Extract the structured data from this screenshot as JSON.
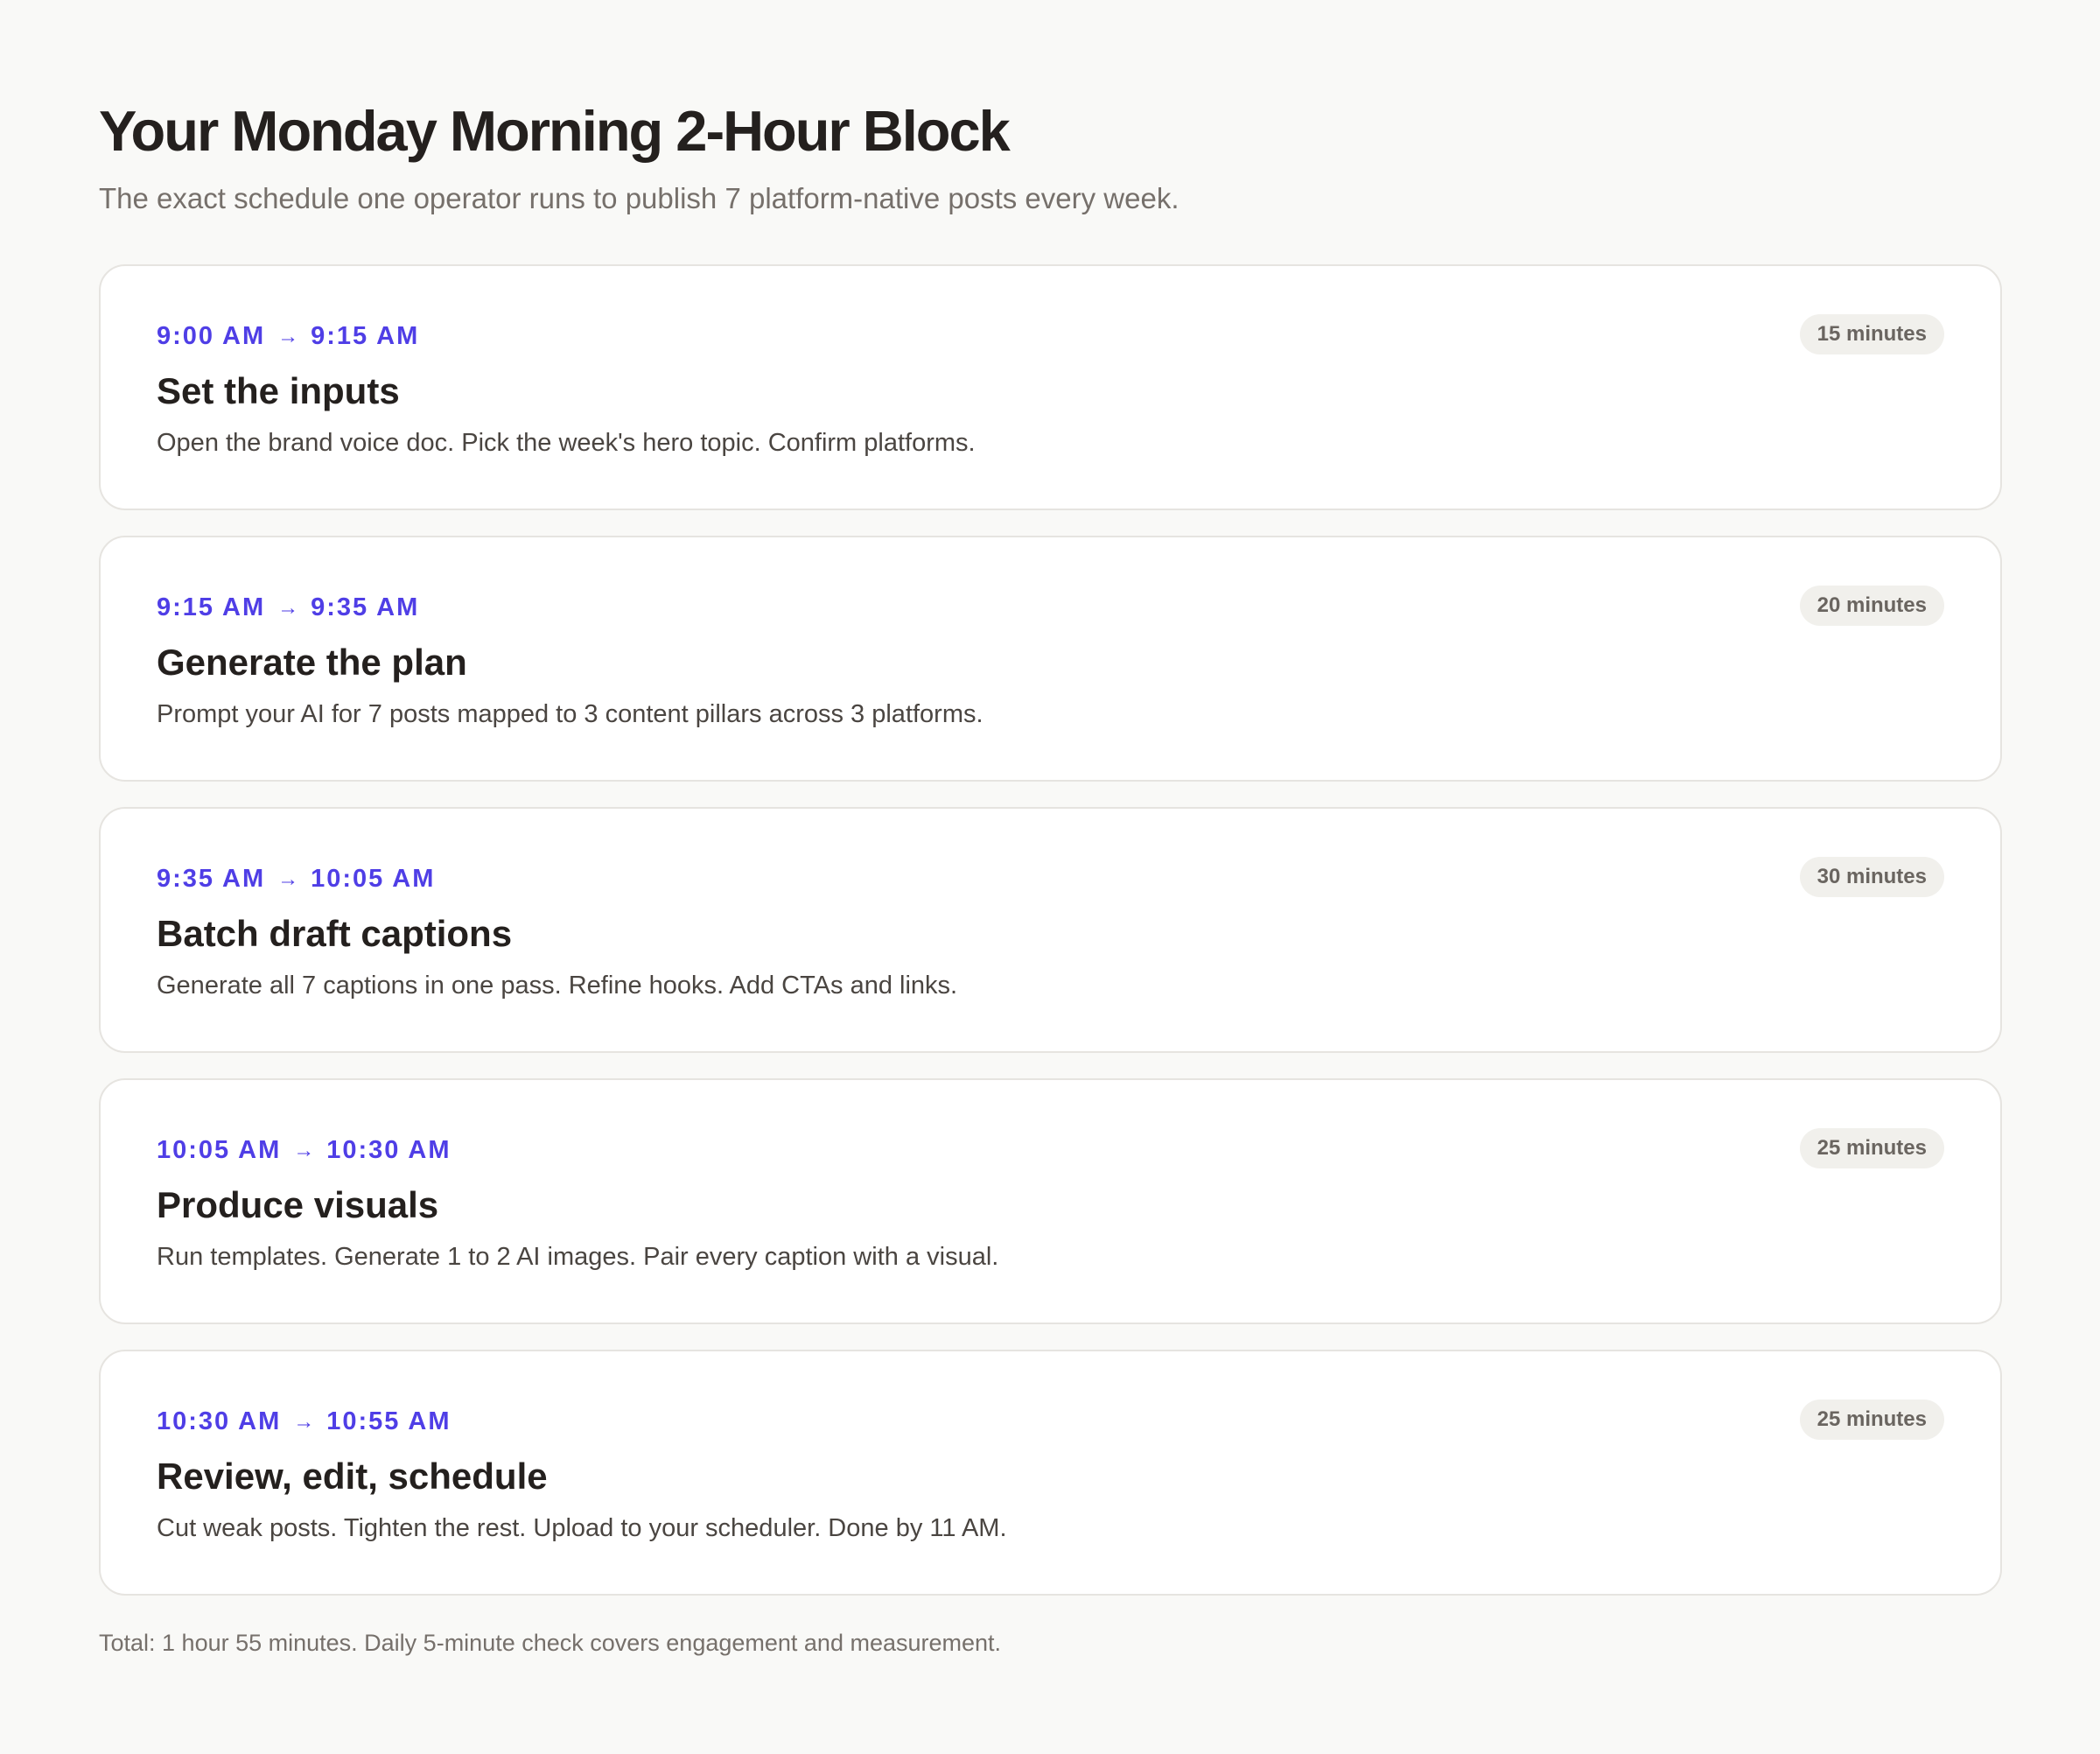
{
  "header": {
    "title": "Your Monday Morning 2-Hour Block",
    "subtitle": "The exact schedule one operator runs to publish 7 platform-native posts every week."
  },
  "arrow_glyph": "→",
  "steps": [
    {
      "start": "9:00 AM",
      "end": "9:15 AM",
      "title": "Set the inputs",
      "description": "Open the brand voice doc. Pick the week's hero topic. Confirm platforms.",
      "duration": "15 minutes"
    },
    {
      "start": "9:15 AM",
      "end": "9:35 AM",
      "title": "Generate the plan",
      "description": "Prompt your AI for 7 posts mapped to 3 content pillars across 3 platforms.",
      "duration": "20 minutes"
    },
    {
      "start": "9:35 AM",
      "end": "10:05 AM",
      "title": "Batch draft captions",
      "description": "Generate all 7 captions in one pass. Refine hooks. Add CTAs and links.",
      "duration": "30 minutes"
    },
    {
      "start": "10:05 AM",
      "end": "10:30 AM",
      "title": "Produce visuals",
      "description": "Run templates. Generate 1 to 2 AI images. Pair every caption with a visual.",
      "duration": "25 minutes"
    },
    {
      "start": "10:30 AM",
      "end": "10:55 AM",
      "title": "Review, edit, schedule",
      "description": "Cut weak posts. Tighten the rest. Upload to your scheduler. Done by 11 AM.",
      "duration": "25 minutes"
    }
  ],
  "footer": {
    "note": "Total: 1 hour 55 minutes. Daily 5-minute check covers engagement and measurement."
  },
  "colors": {
    "accent": "#4f3ee6",
    "background": "#f9f9f7",
    "card": "#ffffff",
    "badge_bg": "#f1f0ec"
  }
}
